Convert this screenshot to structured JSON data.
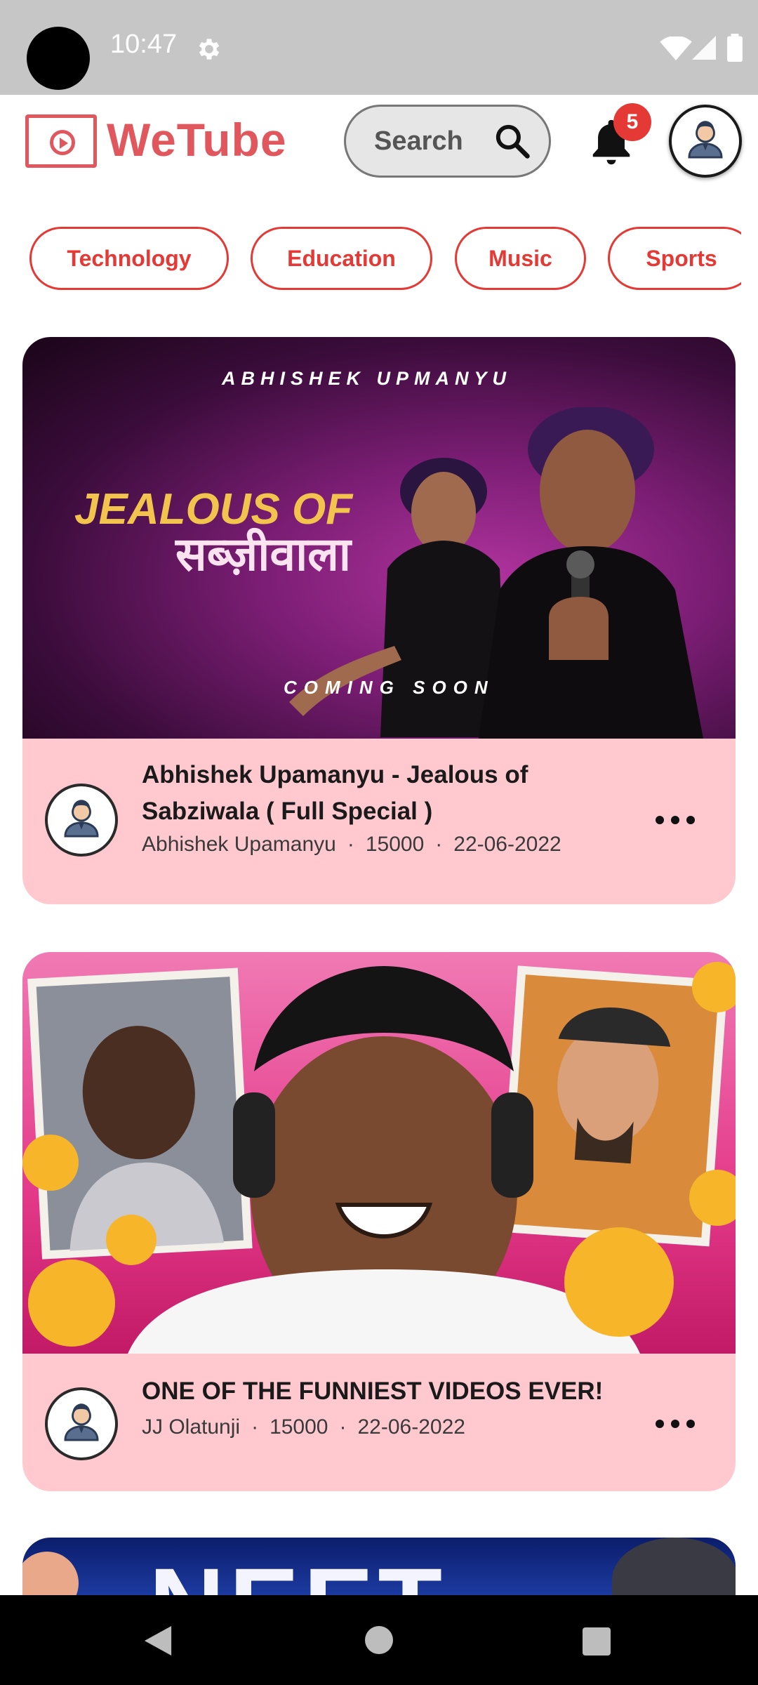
{
  "status_bar": {
    "time": "10:47",
    "icons": [
      "settings-icon",
      "wifi-icon",
      "signal-icon",
      "battery-icon"
    ]
  },
  "header": {
    "logo_text": "WeTube",
    "search_label": "Search",
    "notification_count": "5",
    "colors": {
      "brand": "#e0585e",
      "badge": "#e53935"
    }
  },
  "categories": [
    {
      "label": "Technology"
    },
    {
      "label": "Education"
    },
    {
      "label": "Music"
    },
    {
      "label": "Sports"
    }
  ],
  "videos": [
    {
      "thumbnail_text": {
        "name": "ABHISHEK UPMANYU",
        "headline": "JEALOUS OF",
        "headline_hindi": "सब्ज़ीवाला",
        "footer": "COMING SOON"
      },
      "title": "Abhishek Upamanyu - Jealous of Sabziwala ( Full Special )",
      "channel": "Abhishek Upamanyu",
      "views": "15000",
      "date": "22-06-2022"
    },
    {
      "title": "ONE OF THE FUNNIEST VIDEOS EVER!",
      "channel": "JJ Olatunji",
      "views": "15000",
      "date": "22-06-2022"
    },
    {
      "thumbnail_text": {
        "headline": "NEET"
      }
    }
  ]
}
